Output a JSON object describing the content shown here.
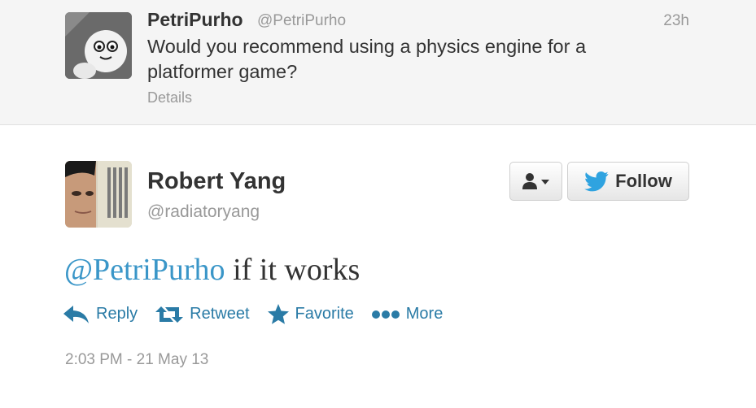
{
  "parent_tweet": {
    "name": "PetriPurho",
    "handle": "@PetriPurho",
    "time": "23h",
    "text": "Would you recommend using a physics engine for a platformer game?",
    "details_label": "Details"
  },
  "tweet": {
    "author_name": "Robert Yang",
    "author_handle": "@radiatoryang",
    "mention": "@PetriPurho",
    "text": " if it works",
    "timestamp": "2:03 PM - 21 May 13"
  },
  "buttons": {
    "follow_label": "Follow"
  },
  "actions": {
    "reply": "Reply",
    "retweet": "Retweet",
    "favorite": "Favorite",
    "more": "More"
  },
  "colors": {
    "link": "#2a7ba6",
    "mention": "#3a96c8",
    "twitter_bird": "#2fa3e0",
    "parent_background": "#f5f5f5"
  },
  "icons": {
    "user_menu": "user-dropdown-icon",
    "follow": "twitter-bird-icon",
    "reply": "reply-arrow-icon",
    "retweet": "retweet-icon",
    "favorite": "star-icon",
    "more": "ellipsis-icon"
  }
}
